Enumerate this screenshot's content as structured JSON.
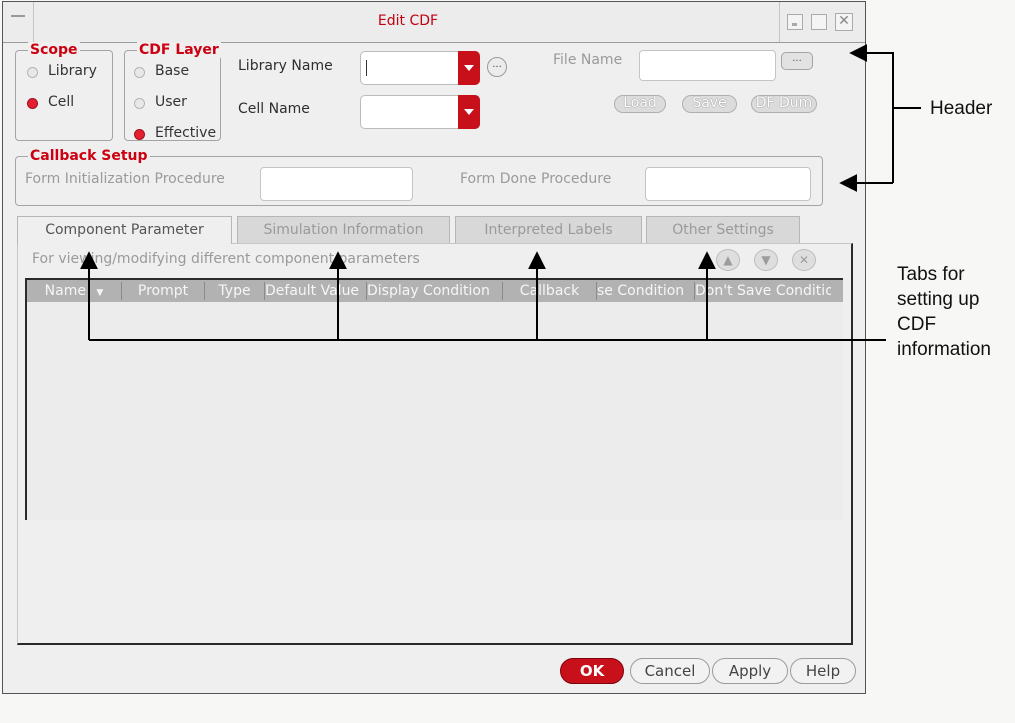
{
  "window": {
    "title": "Edit CDF"
  },
  "scope": {
    "legend": "Scope",
    "options": [
      {
        "label": "Library",
        "selected": false
      },
      {
        "label": "Cell",
        "selected": true
      }
    ]
  },
  "cdf_layer": {
    "legend": "CDF Layer",
    "options": [
      {
        "label": "Base",
        "selected": false
      },
      {
        "label": "User",
        "selected": false
      },
      {
        "label": "Effective",
        "selected": true
      }
    ]
  },
  "header": {
    "library_name_label": "Library Name",
    "library_name_value": "",
    "cell_name_label": "Cell Name",
    "cell_name_value": "",
    "browse_label": "...",
    "file_name_label": "File Name",
    "file_name_value": "",
    "file_browse_label": "...",
    "load_label": "Load",
    "save_label": "Save",
    "dump_label": "DF Dum"
  },
  "callback": {
    "legend": "Callback Setup",
    "init_label": "Form Initialization Procedure",
    "init_value": "",
    "done_label": "Form Done Procedure",
    "done_value": ""
  },
  "tabs": [
    {
      "label": "Component Parameter",
      "active": true
    },
    {
      "label": "Simulation Information",
      "active": false
    },
    {
      "label": "Interpreted Labels",
      "active": false
    },
    {
      "label": "Other Settings",
      "active": false
    }
  ],
  "component_panel": {
    "hint": "For viewing/modifying different component parameters",
    "columns": [
      "Name",
      "Prompt",
      "Type",
      "Default Value",
      "Display Condition",
      "Callback",
      "se Condition",
      "Don't Save Conditio"
    ]
  },
  "footer": {
    "ok": "OK",
    "cancel": "Cancel",
    "apply": "Apply",
    "help": "Help"
  },
  "annotations": {
    "header": "Header",
    "tabs_line1": "Tabs for",
    "tabs_line2": "setting up",
    "tabs_line3": "CDF",
    "tabs_line4": "information"
  },
  "colors": {
    "accent_red": "#c8101a",
    "legend_red": "#cc0010"
  }
}
